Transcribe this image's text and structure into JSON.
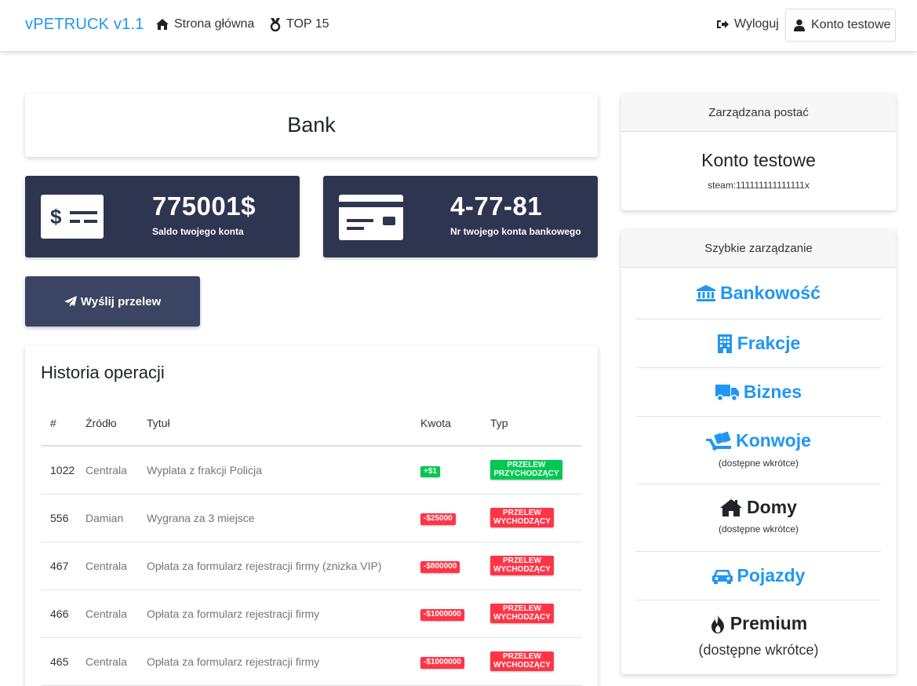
{
  "navbar": {
    "brand": "vPETRUCK v1.1",
    "home_label": "Strona główna",
    "top_label": "TOP 15",
    "logout_label": "Wyloguj",
    "account_label": "Konto testowe"
  },
  "bank": {
    "title": "Bank",
    "balance_value": "775001$",
    "balance_label": "Saldo twojego konta",
    "account_number_value": "4-77-81",
    "account_number_label": "Nr twojego konta bankowego",
    "send_transfer_label": "Wyślij przelew"
  },
  "history": {
    "title": "Historia operacji",
    "columns": [
      "#",
      "Źródło",
      "Tytuł",
      "Kwota",
      "Typ"
    ],
    "rows": [
      {
        "id": "1022",
        "source": "Centrala",
        "title": "Wyplata z frakcji Policja",
        "amount": "+$1",
        "amount_color": "green",
        "type_line1": "PRZELEW",
        "type_line2": "PRZYCHODZĄCY",
        "type_color": "green"
      },
      {
        "id": "556",
        "source": "Damian",
        "title": "Wygrana za 3 miejsce",
        "amount": "-$25000",
        "amount_color": "red",
        "type_line1": "PRZELEW",
        "type_line2": "WYCHODZĄCY",
        "type_color": "red"
      },
      {
        "id": "467",
        "source": "Centrala",
        "title": "Opłata za formularz rejestracji firmy (znizka VIP)",
        "amount": "-$800000",
        "amount_color": "red",
        "type_line1": "PRZELEW",
        "type_line2": "WYCHODZĄCY",
        "type_color": "red"
      },
      {
        "id": "466",
        "source": "Centrala",
        "title": "Opłata za formularz rejestracji firmy",
        "amount": "-$1000000",
        "amount_color": "red",
        "type_line1": "PRZELEW",
        "type_line2": "WYCHODZĄCY",
        "type_color": "red"
      },
      {
        "id": "465",
        "source": "Centrala",
        "title": "Opłata za formularz rejestracji firmy",
        "amount": "-$1000000",
        "amount_color": "red",
        "type_line1": "PRZELEW",
        "type_line2": "WYCHODZĄCY",
        "type_color": "red"
      }
    ]
  },
  "managed": {
    "header": "Zarządzana postać",
    "name": "Konto testowe",
    "steam": "steam:111111111111111x"
  },
  "quick": {
    "header": "Szybkie zarządzanie",
    "items": [
      {
        "label": "Bankowość",
        "icon": "bank-icon",
        "sub": ""
      },
      {
        "label": "Frakcje",
        "icon": "building-icon",
        "sub": ""
      },
      {
        "label": "Biznes",
        "icon": "truck-icon",
        "sub": ""
      },
      {
        "label": "Konwoje",
        "icon": "dolly-icon",
        "sub": "(dostępne wkrótce)"
      },
      {
        "label": "Domy",
        "icon": "home-icon",
        "sub": "(dostępne wkrótce)"
      },
      {
        "label": "Pojazdy",
        "icon": "car-icon",
        "sub": ""
      },
      {
        "label": "Premium",
        "icon": "fire-icon",
        "sub": "(dostępne wkrótce)"
      }
    ]
  },
  "colors": {
    "brand": "#2196f3",
    "stat_bg": "#2d3550",
    "button_bg": "#3b4463",
    "success": "#00c851",
    "danger": "#ff3547"
  }
}
